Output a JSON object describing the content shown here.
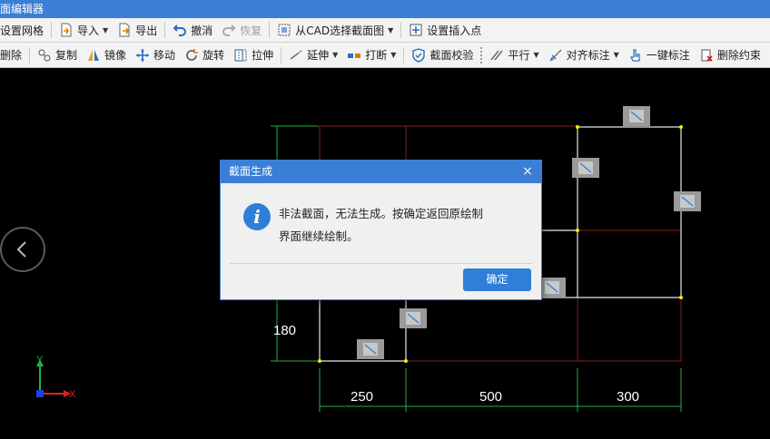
{
  "window": {
    "title": "面编辑器"
  },
  "toolbar1": [
    {
      "name": "grid-button",
      "icon": "grid-icon",
      "label": "设置网格"
    },
    {
      "name": "import-button",
      "icon": "import-icon",
      "label": "导入",
      "dropdown": true
    },
    {
      "name": "export-button",
      "icon": "export-icon",
      "label": "导出"
    },
    {
      "name": "undo-button",
      "icon": "undo-icon",
      "label": "撤消"
    },
    {
      "name": "redo-button",
      "icon": "redo-icon",
      "label": "恢复",
      "disabled": true
    },
    {
      "name": "select-from-cad-button",
      "icon": "cad-select-icon",
      "label": "从CAD选择截面图",
      "dropdown": true
    },
    {
      "name": "set-insert-point-button",
      "icon": "insert-point-icon",
      "label": "设置插入点"
    }
  ],
  "toolbar2": [
    {
      "name": "delete-button",
      "label": "删除"
    },
    {
      "name": "copy-button",
      "label": "复制"
    },
    {
      "name": "mirror-button",
      "label": "镜像"
    },
    {
      "name": "move-button",
      "label": "移动"
    },
    {
      "name": "rotate-button",
      "label": "旋转"
    },
    {
      "name": "stretch-button",
      "label": "拉伸"
    },
    {
      "name": "extend-button",
      "label": "延伸"
    },
    {
      "name": "break-button",
      "label": "打断"
    },
    {
      "name": "section-check-button",
      "label": "截面校验"
    },
    {
      "name": "parallel-button",
      "label": "平行"
    },
    {
      "name": "align-dimension-button",
      "label": "对齐标注"
    },
    {
      "name": "one-click-dimension-button",
      "label": "一键标注"
    },
    {
      "name": "delete-constraint-button",
      "label": "删除约束"
    }
  ],
  "drawing": {
    "dimensions": {
      "left": "180",
      "bottom1": "250",
      "bottom2": "500",
      "bottom3": "300"
    },
    "axes": {
      "x": "X",
      "y": "Y"
    }
  },
  "dialog": {
    "title": "截面生成",
    "message_line1": "非法截面，无法生成。按确定返回原绘制",
    "message_line2": "界面继续绘制。",
    "ok_label": "确定",
    "close_glyph": "×"
  },
  "colors": {
    "accent": "#3a7fd5",
    "canvas_bg": "#000000",
    "line_green": "#22b14c",
    "line_red": "#8b1c1c",
    "line_white": "#e6e6e6",
    "point_yellow": "#ffea00"
  }
}
